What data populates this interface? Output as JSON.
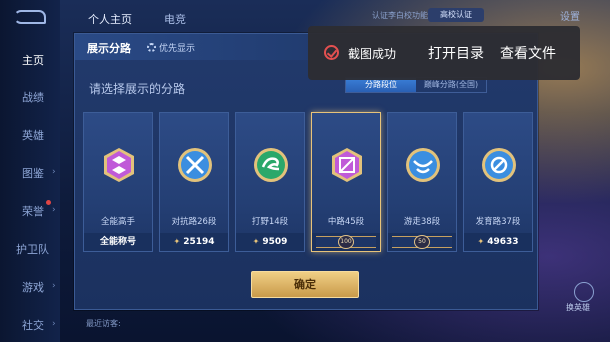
{
  "top_tabs": [
    "个人主页",
    "电竞"
  ],
  "top_hint": "认证李白校功能",
  "verify_badge": "高校认证",
  "settings_label": "设置",
  "left_nav": [
    "主页",
    "战绩",
    "英雄",
    "图鉴",
    "荣誉",
    "护卫队",
    "游戏",
    "社交"
  ],
  "panel": {
    "title": "展示分路",
    "pref_toggle": "优先显示",
    "subtitle": "请选择展示的分路",
    "segments": [
      "分路段位",
      "巅峰分路(全国)"
    ],
    "active_segment": 0,
    "confirm_label": "确定"
  },
  "cards": [
    {
      "name": "全能高手",
      "value": "全能称号",
      "color": "#c05ad8",
      "selected": false
    },
    {
      "name": "对抗路26段",
      "value": "25194",
      "color": "#3b8ee0",
      "selected": false
    },
    {
      "name": "打野14段",
      "value": "9509",
      "color": "#2aa86a",
      "selected": false
    },
    {
      "name": "中路45段",
      "value": "100",
      "color": "#c05ad8",
      "selected": true,
      "star_badge": "100"
    },
    {
      "name": "游走38段",
      "value": "50",
      "color": "#3b8ee0",
      "selected": false,
      "star_badge": "50"
    },
    {
      "name": "发育路37段",
      "value": "49633",
      "color": "#3b8ee0",
      "selected": false
    }
  ],
  "toast": {
    "message": "截图成功",
    "actions": [
      "打开目录",
      "查看文件"
    ]
  },
  "bottom": {
    "recent": "最近访客:",
    "swap": "换英雄"
  },
  "colors": {
    "accent_gold": "#e7c37a",
    "segment_active": "#3a7fd8",
    "toast_check": "#e35050"
  }
}
